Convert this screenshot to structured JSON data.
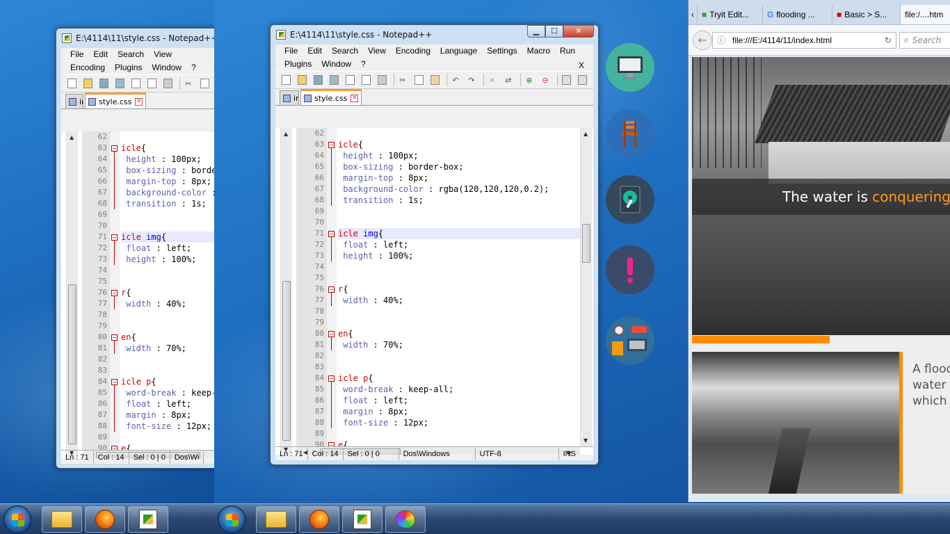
{
  "code_lines": [
    {
      "n": "62",
      "t": ""
    },
    {
      "n": "63",
      "s": "icle",
      "rest": "{"
    },
    {
      "n": "64",
      "p": "height",
      "v": " : 100px;"
    },
    {
      "n": "65",
      "p": "box-sizing",
      "v": " : border-box;"
    },
    {
      "n": "66",
      "p": "margin-top",
      "v": " : 8px;"
    },
    {
      "n": "67",
      "p": "background-color",
      "v": " : rgba(120,120,120,0.2);"
    },
    {
      "n": "68",
      "p": "transition",
      "v": " : 1s;"
    },
    {
      "n": "69",
      "t": ""
    },
    {
      "n": "70",
      "t": ""
    },
    {
      "n": "71",
      "s": "icle ",
      "tag": "img",
      "rest": "{"
    },
    {
      "n": "72",
      "p": "float",
      "v": " : left;"
    },
    {
      "n": "73",
      "p": "height",
      "v": " : 100%;"
    },
    {
      "n": "74",
      "t": ""
    },
    {
      "n": "75",
      "t": ""
    },
    {
      "n": "76",
      "s": "r",
      "rest": "{"
    },
    {
      "n": "77",
      "p": "width",
      "v": " : 40%;"
    },
    {
      "n": "78",
      "t": ""
    },
    {
      "n": "79",
      "t": ""
    },
    {
      "n": "80",
      "s": "en",
      "rest": "{"
    },
    {
      "n": "81",
      "p": "width",
      "v": " : 70%;"
    },
    {
      "n": "82",
      "t": ""
    },
    {
      "n": "83",
      "t": ""
    },
    {
      "n": "84",
      "s": "icle p",
      "rest": "{"
    },
    {
      "n": "85",
      "p": "word-break",
      "v": " : keep-all;"
    },
    {
      "n": "86",
      "p": "float",
      "v": " : left;"
    },
    {
      "n": "87",
      "p": "margin",
      "v": " : 8px;"
    },
    {
      "n": "88",
      "p": "font-size",
      "v": " : 12px;"
    },
    {
      "n": "89",
      "t": ""
    },
    {
      "n": "90",
      "s": "e",
      "rest": "{"
    }
  ],
  "left_window": {
    "title": "E:\\4114\\11\\style.css - Notepad++",
    "menu": [
      "File",
      "Edit",
      "Search",
      "View",
      "Encoding",
      "Plugins",
      "Window",
      "?"
    ],
    "tabs": [
      "in",
      "style.css"
    ],
    "status": {
      "ln": "Ln : 71",
      "col": "Col : 14",
      "sel": "Sel : 0 | 0",
      "eol": "Dos\\Wi"
    }
  },
  "main_window": {
    "title": "E:\\4114\\11\\style.css - Notepad++",
    "menu": [
      "File",
      "Edit",
      "Search",
      "View",
      "Encoding",
      "Language",
      "Settings",
      "Macro",
      "Run",
      "Plugins",
      "Window",
      "?"
    ],
    "menu_close": "X",
    "tabs": [
      "in",
      "style.css"
    ],
    "status": {
      "ln": "Ln : 71",
      "col": "Col : 14",
      "sel": "Sel : 0 | 0",
      "eol": "Dos\\Windows",
      "enc": "UTF-8",
      "mode": "INS"
    }
  },
  "side_icons": [
    "monitor-icon",
    "chair-icon",
    "hard-drive-icon",
    "exclamation-icon",
    "workspace-icon"
  ],
  "browser": {
    "tabs": [
      "Tryit Edit...",
      "flooding ...",
      "Basic > S...",
      "file:/....htm"
    ],
    "url": "file:///E:/4114/11/index.html",
    "search_placeholder": "Search",
    "hero_text": "The water is ",
    "hero_highlight": "conquering",
    "article_text": "A flood\nwater t\nwhich i"
  },
  "taskbar_buttons": [
    "windows-explorer",
    "firefox",
    "notepad-plus-plus",
    "paint"
  ],
  "colors": {
    "accent": "#ff8c00",
    "selector": "#d00000",
    "property": "#6060b0",
    "tag": "#0000ee"
  }
}
